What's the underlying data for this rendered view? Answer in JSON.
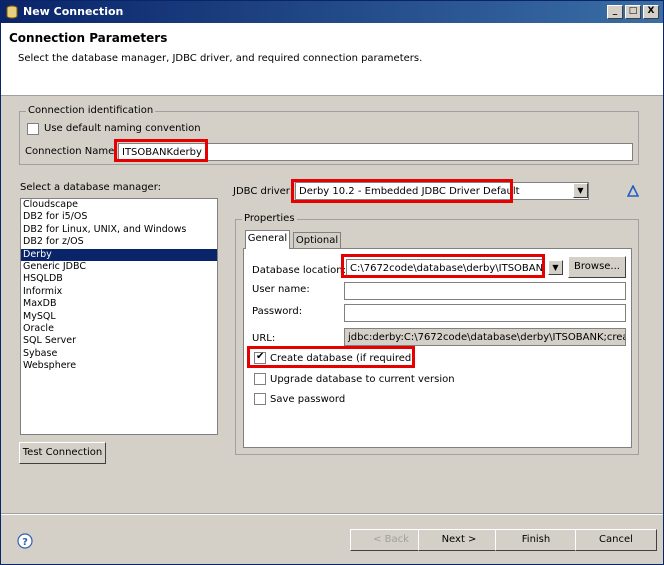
{
  "window": {
    "title": "New Connection",
    "controls": {
      "minimize": "_",
      "maximize": "□",
      "close": "X"
    }
  },
  "header": {
    "title": "Connection Parameters",
    "description": "Select the database manager, JDBC driver, and required connection parameters."
  },
  "connection_identification": {
    "group_label": "Connection identification",
    "use_default_label": "Use default naming convention",
    "use_default_checked": false,
    "name_label": "Connection Name:",
    "name_value": "ITSOBANKderby"
  },
  "db_manager": {
    "label": "Select a database manager:",
    "items": [
      "Cloudscape",
      "DB2 for i5/OS",
      "DB2 for Linux, UNIX, and Windows",
      "DB2 for z/OS",
      "Derby",
      "Generic JDBC",
      "HSQLDB",
      "Informix",
      "MaxDB",
      "MySQL",
      "Oracle",
      "SQL Server",
      "Sybase",
      "Websphere"
    ],
    "selected": "Derby"
  },
  "jdbc": {
    "label": "JDBC driver:",
    "value": "Derby 10.2 - Embedded JDBC Driver Default"
  },
  "properties": {
    "group_label": "Properties",
    "tabs": [
      "General",
      "Optional"
    ],
    "active_tab": "General",
    "db_location_label": "Database location:",
    "db_location_value": "C:\\7672code\\database\\derby\\ITSOBANK",
    "browse_label": "Browse...",
    "user_label": "User name:",
    "user_value": "",
    "password_label": "Password:",
    "password_value": "",
    "url_label": "URL:",
    "url_value": "jdbc:derby:C:\\7672code\\database\\derby\\ITSOBANK;creat",
    "create_db_label": "Create database (if required)",
    "create_db_checked": true,
    "upgrade_label": "Upgrade database to current version",
    "upgrade_checked": false,
    "save_password_label": "Save password",
    "save_password_checked": false
  },
  "buttons": {
    "test": "Test Connection",
    "back": "< Back",
    "next": "Next >",
    "finish": "Finish",
    "cancel": "Cancel"
  },
  "colors": {
    "highlight": "#e60000",
    "selection": "#0a246a",
    "titlebar": "#0a246a"
  },
  "icons": [
    "app-icon",
    "warning-icon",
    "help-icon",
    "dropdown-arrow-icon"
  ]
}
